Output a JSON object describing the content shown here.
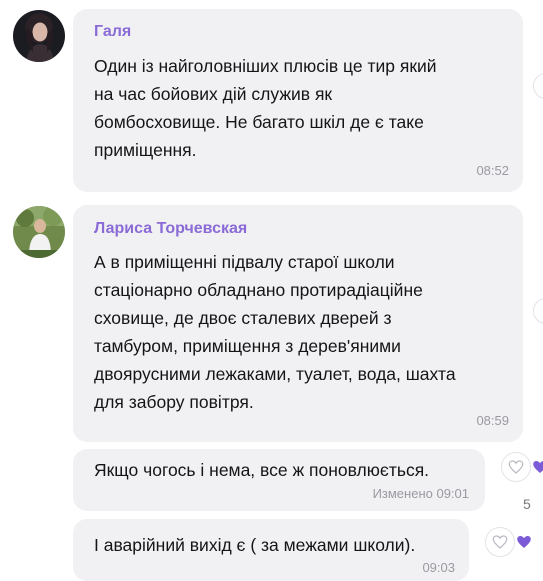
{
  "messages": [
    {
      "sender": "Галя",
      "lines": [
        "Один із найголовніших плюсів це тир який",
        "на час бойових дій служив як",
        "бомбосховище. Не багато шкіл де є таке",
        "приміщення."
      ],
      "time": "08:52"
    },
    {
      "sender": "Лариса Торчевская",
      "lines": [
        "А в приміщенні підвалу старої школи",
        "стаціонарно обладнано протирадіаційне",
        "сховище, де двоє сталевих дверей з",
        "тамбуром, приміщення з дерев'яними",
        "двоярусними лежаками, туалет, вода, шахта",
        "для забору повітря."
      ],
      "time": "08:59"
    },
    {
      "text": "Якщо чогось і нема, все ж поновлюється.",
      "time": "Изменено 09:01",
      "reaction_count": "5"
    },
    {
      "text": "І аварійний вихід є ( за межами школи).",
      "time": "09:03"
    }
  ],
  "colors": {
    "sender_name": "#8b6bd6",
    "bubble": "#f1f1f4",
    "heart": "#7b5bd6"
  },
  "icons": [
    "avatar-galya",
    "avatar-larysa",
    "heart-outline-icon",
    "heart-filled-icon"
  ]
}
